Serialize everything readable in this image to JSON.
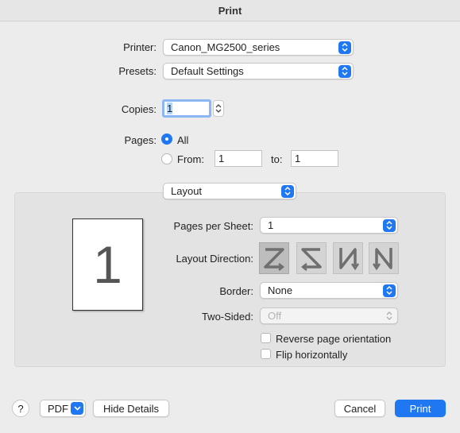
{
  "window": {
    "title": "Print"
  },
  "printer": {
    "label": "Printer:",
    "value": "Canon_MG2500_series"
  },
  "presets": {
    "label": "Presets:",
    "value": "Default Settings"
  },
  "copies": {
    "label": "Copies:",
    "value": "1"
  },
  "pages": {
    "label": "Pages:",
    "all_label": "All",
    "from_label": "From:",
    "from_value": "1",
    "to_label": "to:",
    "to_value": "1",
    "selected": "All"
  },
  "section": {
    "value": "Layout"
  },
  "layout": {
    "preview_number": "1",
    "pages_per_sheet_label": "Pages per Sheet:",
    "pages_per_sheet_value": "1",
    "layout_direction_label": "Layout Direction:",
    "directions": [
      "z-right-down",
      "z-left-down",
      "n-down-right",
      "n-down-left"
    ],
    "border_label": "Border:",
    "border_value": "None",
    "two_sided_label": "Two-Sided:",
    "two_sided_value": "Off",
    "reverse_label": "Reverse page orientation",
    "flip_label": "Flip horizontally",
    "reverse_checked": false,
    "flip_checked": false
  },
  "footer": {
    "help_label": "?",
    "pdf_label": "PDF",
    "hide_details_label": "Hide Details",
    "cancel_label": "Cancel",
    "print_label": "Print"
  },
  "colors": {
    "accent": "#1f78f2",
    "background": "#ececec",
    "panel": "#e3e3e3"
  }
}
